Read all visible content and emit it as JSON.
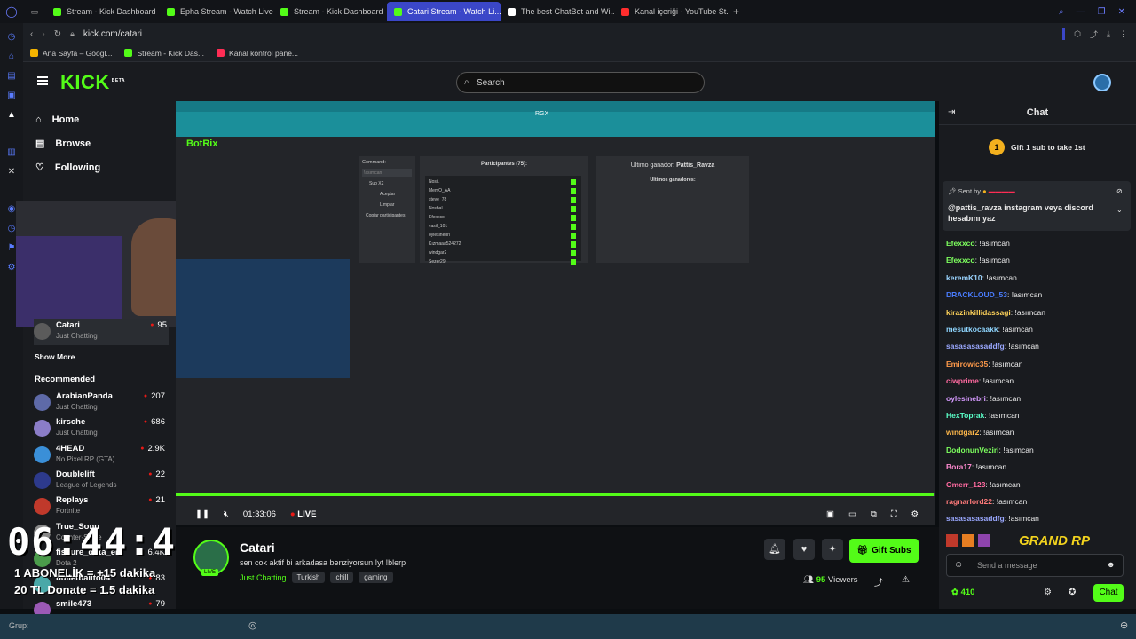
{
  "browser": {
    "tabs": [
      {
        "label": "Stream - Kick Dashboard",
        "color": "#53fc18"
      },
      {
        "label": "Epha Stream - Watch Live",
        "color": "#53fc18"
      },
      {
        "label": "Stream - Kick Dashboard",
        "color": "#53fc18"
      },
      {
        "label": "Catari Stream - Watch Li...",
        "color": "#53fc18",
        "active": true
      },
      {
        "label": "The best ChatBot and Wi...",
        "color": "#ffffff"
      },
      {
        "label": "Kanal içeriği - YouTube St...",
        "color": "#ff2d2d"
      }
    ],
    "url": "kick.com/catari",
    "bookmarks": [
      "Ana Sayfa – Googl...",
      "Stream - Kick Das...",
      "Kanal kontrol pane..."
    ]
  },
  "header": {
    "logo": "KICK",
    "logo_badge": "BETA",
    "search_placeholder": "Search"
  },
  "sidebar": {
    "nav": [
      {
        "label": "Home",
        "icon": "home-icon"
      },
      {
        "label": "Browse",
        "icon": "browse-icon"
      },
      {
        "label": "Following",
        "icon": "heart-icon"
      }
    ],
    "followed": {
      "name": "Catari",
      "category": "Just Chatting",
      "viewers": "95"
    },
    "show_more": "Show More",
    "recommended_title": "Recommended",
    "recommended": [
      {
        "name": "ArabianPanda",
        "category": "Just Chatting",
        "viewers": "207"
      },
      {
        "name": "kirsche",
        "category": "Just Chatting",
        "viewers": "686"
      },
      {
        "name": "4HEAD",
        "category": "No Pixel RP (GTA)",
        "viewers": "2.9K"
      },
      {
        "name": "Doublelift",
        "category": "League of Legends",
        "viewers": "22"
      },
      {
        "name": "Replays",
        "category": "Fortnite",
        "viewers": "21"
      },
      {
        "name": "True_Sonu",
        "category": "Counter-Strike",
        "viewers": ""
      },
      {
        "name": "fissure_dota_en",
        "category": "Dota 2",
        "viewers": "6.4K"
      },
      {
        "name": "bulletballto04",
        "category": "",
        "viewers": "83"
      },
      {
        "name": "smile473",
        "category": "",
        "viewers": "79"
      }
    ]
  },
  "player": {
    "botrix": "BotRix",
    "command_label": "Command:",
    "command_value": "!asımcan",
    "sub_x2": "Sub X2",
    "accept": "Aceptar",
    "clear": "Limpiar",
    "copy": "Copiar participantes",
    "participants_title": "Participantes (75):",
    "participants": [
      "Nosil.",
      "MemO_AA",
      "steve_78",
      "Nosbal",
      "Efexxco",
      "vasil_101",
      "oylesinebri",
      "Kızmaaa524272",
      "windgar2",
      "Sezer29"
    ],
    "last_winner_label": "Ultimo ganador:",
    "last_winner": "Pattis_Ravza",
    "last_winners_label": "Ultimos ganadores:",
    "inner_tab_badge": "RGX",
    "time": "01:33:06",
    "live": "LIVE",
    "progress": 0.999
  },
  "overlay": {
    "timer": "06:44:47",
    "line1": "1 ABONELİK = +15 dakika",
    "line2": "20 TL Donate = 1.5 dakika"
  },
  "stream_info": {
    "channel": "Catari",
    "live_badge": "LIVE",
    "title": "sen cok aktif bi arkadasa benziyorsun !yt !blerp",
    "category": "Just Chatting",
    "tags": [
      "Turkish",
      "chill",
      "gaming"
    ],
    "viewers": "95",
    "viewers_label": "Viewers",
    "gift_subs": "Gift Subs"
  },
  "chat": {
    "title": "Chat",
    "gift_rank": "1",
    "gift_text": "Gift 1 sub to take 1st",
    "pinned_label": "Sent by",
    "pinned_message": "@pattis_ravza instagram veya discord hesabını yaz",
    "messages": [
      {
        "user": "Efexxco",
        "color": "#7dff5e",
        "text": "!asımcan"
      },
      {
        "user": "Efexxco",
        "color": "#7dff5e",
        "text": "!asımcan"
      },
      {
        "user": "keremK10",
        "color": "#9ad4ff",
        "text": "!asımcan"
      },
      {
        "user": "DRACKLOUD_53",
        "color": "#4a7dff",
        "text": "!asımcan"
      },
      {
        "user": "kirazinkillidassagi",
        "color": "#ffd35a",
        "text": "!asımcan"
      },
      {
        "user": "mesutkocaakk",
        "color": "#8fd6ff",
        "text": "!asımcan"
      },
      {
        "user": "sasasasasaddfg",
        "color": "#9aa8ff",
        "text": "!asımcan"
      },
      {
        "user": "Emirowic35",
        "color": "#ff9a4a",
        "text": "!asımcan"
      },
      {
        "user": "ciwprime",
        "color": "#ff6aa0",
        "text": "!asımcan"
      },
      {
        "user": "oylesinebri",
        "color": "#d69aff",
        "text": "!asımcan"
      },
      {
        "user": "HexToprak",
        "color": "#5affc8",
        "text": "!asımcan"
      },
      {
        "user": "windgar2",
        "color": "#ffb84a",
        "text": "!asımcan"
      },
      {
        "user": "DodonunVeziri",
        "color": "#7dff5e",
        "text": "!asımcan"
      },
      {
        "user": "Bora17",
        "color": "#ff8ad0",
        "text": "!asımcan"
      },
      {
        "user": "Omerr_123",
        "color": "#ff6aa0",
        "text": "!asımcan"
      },
      {
        "user": "ragnarlord22",
        "color": "#ff7a7a",
        "text": "!asımcan"
      },
      {
        "user": "sasasasasaddfg",
        "color": "#9aa8ff",
        "text": "!asımcan"
      }
    ],
    "sponsor_text": "GRAND RP",
    "input_placeholder": "Send a message",
    "points": "410",
    "send": "Chat"
  },
  "taskbar": {
    "group_label": "Grup:"
  }
}
